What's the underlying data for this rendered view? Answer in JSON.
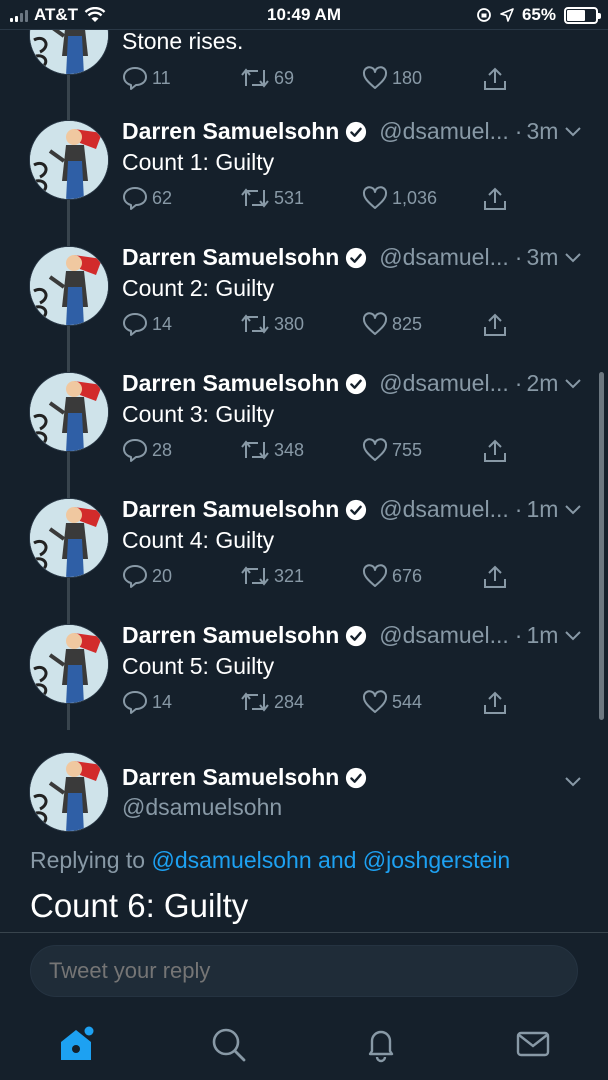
{
  "status_bar": {
    "carrier": "AT&T",
    "time": "10:49 AM",
    "battery_percent": "65%",
    "battery_level": 0.65,
    "signal_bars": 2
  },
  "partial_tweet": {
    "text": "Stone rises.",
    "replies": "11",
    "retweets": "69",
    "likes": "180"
  },
  "tweets": [
    {
      "author": "Darren Samuelsohn",
      "handle": "@dsamuel...",
      "time": "3m",
      "text": "Count 1: Guilty",
      "replies": "62",
      "retweets": "531",
      "likes": "1,036"
    },
    {
      "author": "Darren Samuelsohn",
      "handle": "@dsamuel...",
      "time": "3m",
      "text": "Count 2: Guilty",
      "replies": "14",
      "retweets": "380",
      "likes": "825"
    },
    {
      "author": "Darren Samuelsohn",
      "handle": "@dsamuel...",
      "time": "2m",
      "text": "Count 3: Guilty",
      "replies": "28",
      "retweets": "348",
      "likes": "755"
    },
    {
      "author": "Darren Samuelsohn",
      "handle": "@dsamuel...",
      "time": "1m",
      "text": "Count 4: Guilty",
      "replies": "20",
      "retweets": "321",
      "likes": "676"
    },
    {
      "author": "Darren Samuelsohn",
      "handle": "@dsamuel...",
      "time": "1m",
      "text": "Count 5: Guilty",
      "replies": "14",
      "retweets": "284",
      "likes": "544"
    }
  ],
  "main_tweet": {
    "author": "Darren Samuelsohn",
    "handle": "@dsamuelsohn",
    "replying_prefix": "Replying to ",
    "replying_user1": "@dsamuelsohn",
    "replying_and": " and ",
    "replying_user2": "@joshgerstein",
    "text": "Count 6: Guilty"
  },
  "reply_bar": {
    "placeholder": "Tweet your reply"
  },
  "tab_bar": {
    "items": [
      "home-icon",
      "search-icon",
      "notifications-icon",
      "messages-icon"
    ],
    "active": "home-icon"
  },
  "colors": {
    "background": "#15202b",
    "accent": "#1da1f2",
    "secondary_text": "#8899a6"
  }
}
